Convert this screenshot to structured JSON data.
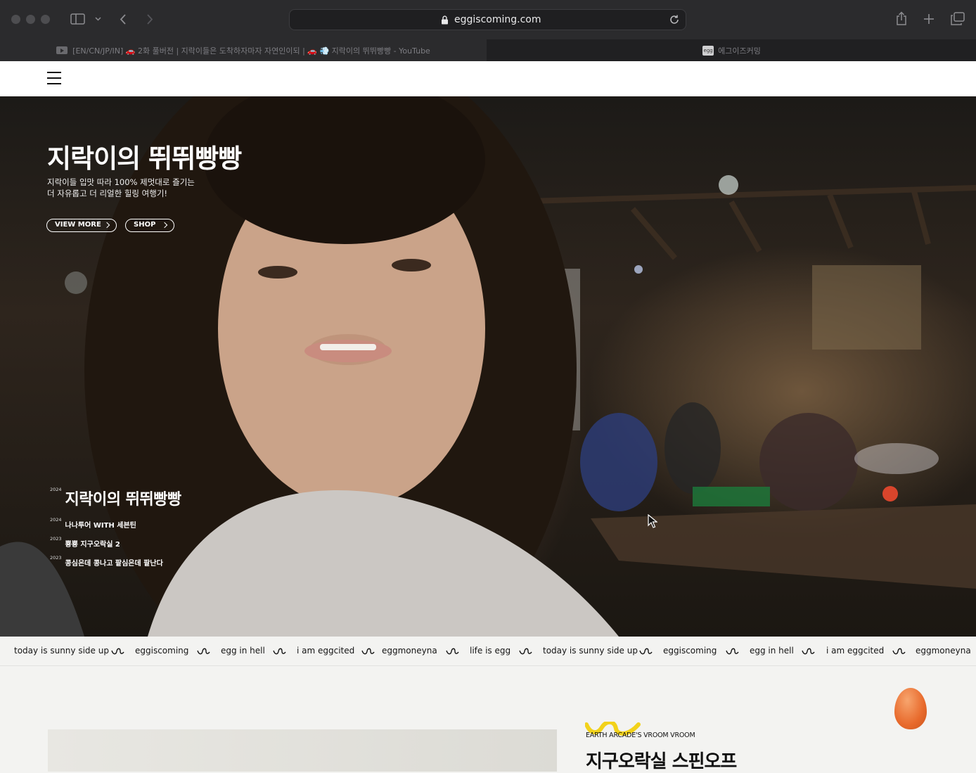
{
  "browser": {
    "url": "eggiscoming.com",
    "tabs": [
      {
        "label": "[EN/CN/JP/IN] 🚗 2화 풀버전 | 지락이들은 도착하자마자 자연인이되 | 🚗 💨 지락이의 뛰뛰빵빵 - YouTube",
        "active": true
      },
      {
        "label": "에그이즈커밍",
        "active": false
      }
    ],
    "favicon_egg_text": "egg"
  },
  "site": {
    "menu_icon": "hamburger-menu-icon"
  },
  "hero": {
    "title": "지락이의 뛰뛰빵빵",
    "subtitle_line1": "지락이들 입맛 따라 100% 제멋대로 즐기는",
    "subtitle_line2": "더 자유롭고 더 리얼한 힐링 여행기!",
    "buttons": [
      {
        "label": "VIEW MORE"
      },
      {
        "label": "SHOP"
      }
    ],
    "programs": [
      {
        "year": "2024",
        "title": "지락이의 뛰뛰빵빵",
        "current": true
      },
      {
        "year": "2024",
        "title": "나나투어 WITH 세븐틴",
        "current": false
      },
      {
        "year": "2023",
        "title": "뿅뿅 지구오락실 2",
        "current": false
      },
      {
        "year": "2023",
        "title": "콩심은데 콩나고 팥심은데 팥난다",
        "current": false
      }
    ]
  },
  "marquee": [
    "today is sunny side up",
    "eggiscoming",
    "egg in hell",
    "i am eggcited",
    "eggmoneyna",
    "life is egg",
    "today is sunny side up",
    "eggiscoming",
    "egg in hell",
    "i am eggcited",
    "eggmoneyna"
  ],
  "feature": {
    "eyebrow": "EARTH ARCADE'S VROOM VROOM",
    "heading": "지구오락실 스핀오프"
  },
  "colors": {
    "egg": "#e86a2c",
    "accent_yellow": "#f2d21b",
    "chrome_bg": "#2b2b2d"
  }
}
